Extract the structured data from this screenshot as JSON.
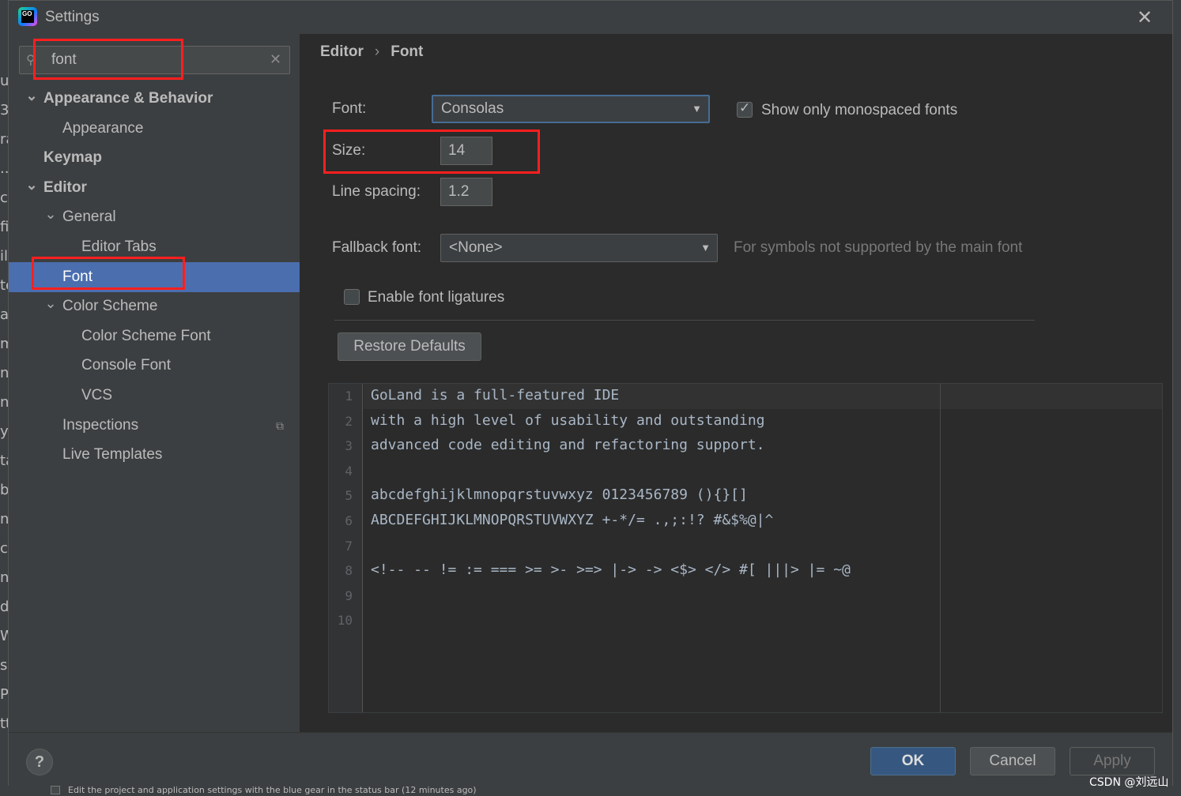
{
  "window": {
    "title": "Settings"
  },
  "search": {
    "value": "font"
  },
  "tree": [
    {
      "label": "Appearance & Behavior",
      "bold": true,
      "expanded": true
    },
    {
      "label": "Appearance"
    },
    {
      "label": "Keymap",
      "bold": true
    },
    {
      "label": "Editor",
      "bold": true,
      "expanded": true
    },
    {
      "label": "General",
      "expanded": true
    },
    {
      "label": "Editor Tabs"
    },
    {
      "label": "Font",
      "selected": true
    },
    {
      "label": "Color Scheme",
      "expanded": true
    },
    {
      "label": "Color Scheme Font"
    },
    {
      "label": "Console Font"
    },
    {
      "label": "VCS"
    },
    {
      "label": "Inspections"
    },
    {
      "label": "Live Templates"
    }
  ],
  "breadcrumb": {
    "parent": "Editor",
    "current": "Font"
  },
  "form": {
    "font_label": "Font:",
    "font_value": "Consolas",
    "mono_checkbox_label": "Show only monospaced fonts",
    "mono_checked": true,
    "size_label": "Size:",
    "size_value": "14",
    "spacing_label": "Line spacing:",
    "spacing_value": "1.2",
    "fallback_label": "Fallback font:",
    "fallback_value": "<None>",
    "fallback_hint": "For symbols not supported by the main font",
    "ligatures_label": "Enable font ligatures",
    "ligatures_checked": false,
    "restore_label": "Restore Defaults"
  },
  "preview": {
    "lines": [
      "GoLand is a full-featured IDE",
      "with a high level of usability and outstanding",
      "advanced code editing and refactoring support.",
      "",
      "abcdefghijklmnopqrstuvwxyz 0123456789 (){}[]",
      "ABCDEFGHIJKLMNOPQRSTUVWXYZ +-*/= .,;:!? #&$%@|^",
      "",
      "<!-- -- != := === >= >- >=> |-> -> <$> </> #[ |||> |= ~@",
      "",
      ""
    ]
  },
  "buttons": {
    "help": "?",
    "ok": "OK",
    "cancel": "Cancel",
    "apply": "Apply"
  },
  "background": {
    "status_text": "Edit the project and application settings with the blue gear in the status bar (12 minutes ago)",
    "left_chars": [
      "u",
      "3",
      "ra",
      "..",
      "ch",
      "fi",
      "il",
      "te",
      "ac",
      "m",
      "n",
      "n",
      "yp",
      "ta",
      "b",
      "nb",
      "co",
      "n",
      "d",
      "W",
      "s",
      "Pr",
      "tt"
    ]
  },
  "watermark": "CSDN @刘远山",
  "colors": {
    "selection": "#4b6eaf",
    "ok_button": "#365880",
    "annotation_red": "#ff1f1f"
  }
}
